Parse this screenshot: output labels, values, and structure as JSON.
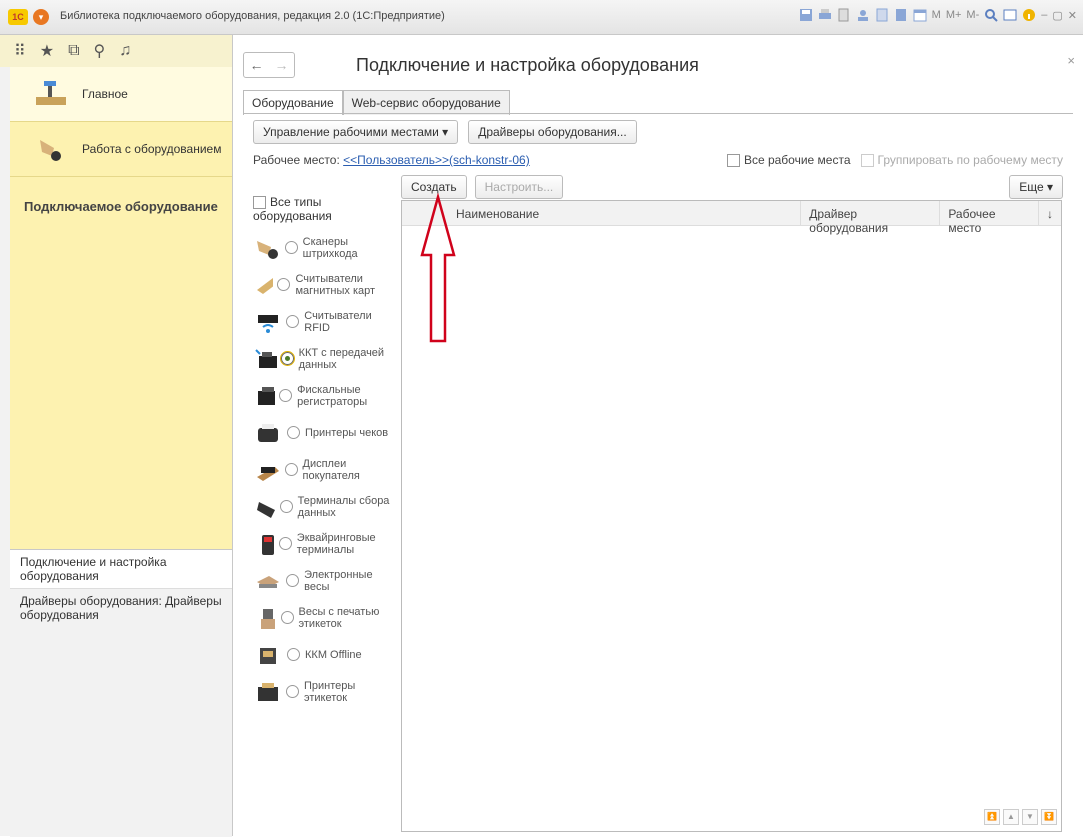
{
  "window": {
    "title": "Библиотека подключаемого оборудования, редакция 2.0 (1С:Предприятие)",
    "logo_text": "1С",
    "toolbar_labels": [
      "M",
      "M+",
      "M-"
    ]
  },
  "sidebar": {
    "sections": [
      {
        "label": "Главное",
        "icon": "scanner-desk-icon"
      },
      {
        "label": "Работа с оборудованием",
        "icon": "barcode-scanner-icon"
      }
    ],
    "heading": "Подключаемое оборудование",
    "links": [
      {
        "label": "Подключение и настройка оборудования"
      },
      {
        "label": "Драйверы оборудования: Драйверы оборудования"
      }
    ]
  },
  "main": {
    "title": "Подключение и настройка оборудования",
    "tabs": [
      {
        "label": "Оборудование"
      },
      {
        "label": "Web-сервис оборудование"
      }
    ],
    "buttons": {
      "manage_workplaces": "Управление рабочими местами",
      "drivers": "Драйверы оборудования...",
      "create": "Создать",
      "configure": "Настроить...",
      "more": "Еще"
    },
    "workplace": {
      "label": "Рабочее место:",
      "value": "<<Пользователь>>(sch-konstr-06)"
    },
    "checks": {
      "all_workplaces": "Все рабочие места",
      "group_by_workplace": "Группировать по рабочему месту",
      "all_types": "Все типы оборудования"
    },
    "equipment_types": [
      {
        "label": "Сканеры штрихкода",
        "icon": "barcode-scanner-icon",
        "selected": false
      },
      {
        "label": "Считыватели магнитных карт",
        "icon": "magnetic-card-reader-icon",
        "selected": false
      },
      {
        "label": "Считыватели RFID",
        "icon": "rfid-reader-icon",
        "selected": false
      },
      {
        "label": "ККТ с передачей данных",
        "icon": "online-kkt-icon",
        "selected": true
      },
      {
        "label": "Фискальные регистраторы",
        "icon": "fiscal-registrar-icon",
        "selected": false
      },
      {
        "label": "Принтеры чеков",
        "icon": "receipt-printer-icon",
        "selected": false
      },
      {
        "label": "Дисплеи покупателя",
        "icon": "customer-display-icon",
        "selected": false
      },
      {
        "label": "Терминалы сбора данных",
        "icon": "data-terminal-icon",
        "selected": false
      },
      {
        "label": "Эквайринговые терминалы",
        "icon": "acquiring-terminal-icon",
        "selected": false
      },
      {
        "label": "Электронные весы",
        "icon": "electronic-scales-icon",
        "selected": false
      },
      {
        "label": "Весы с печатью этикеток",
        "icon": "label-scales-icon",
        "selected": false
      },
      {
        "label": "ККМ Offline",
        "icon": "kkm-offline-icon",
        "selected": false
      },
      {
        "label": "Принтеры этикеток",
        "icon": "label-printer-icon",
        "selected": false
      }
    ],
    "grid": {
      "columns": [
        "Наименование",
        "Драйвер оборудования",
        "Рабочее место"
      ],
      "rows": []
    }
  },
  "colors": {
    "accent_yellow": "#fdf2b0",
    "arrow_red": "#d0021b",
    "link_blue": "#2a5db0"
  }
}
